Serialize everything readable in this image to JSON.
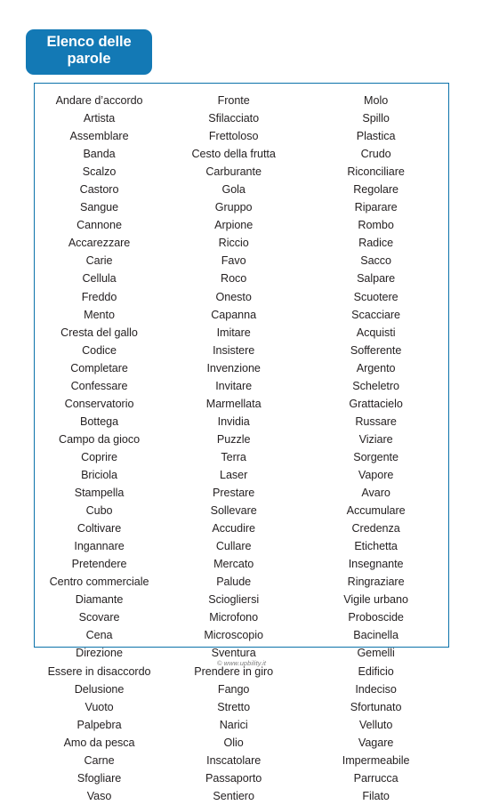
{
  "header": {
    "badge_label": "Elenco delle\nparole",
    "badge_color": "#1379b5",
    "badge_text_color": "#ffffff"
  },
  "word_box": {
    "border_color": "#0b72aa",
    "text_color": "#231f20",
    "columns": [
      {
        "name": "column-1",
        "words": [
          "Andare d’accordo",
          "Artista",
          "Assemblare",
          "Banda",
          "Scalzo",
          "Castoro",
          "Sangue",
          "Cannone",
          "Accarezzare",
          "Carie",
          "Cellula",
          "Freddo",
          "Mento",
          "Cresta del gallo",
          "Codice",
          "Completare",
          "Confessare",
          "Conservatorio",
          "Bottega",
          "Campo da gioco",
          "Coprire",
          "Briciola",
          "Stampella",
          "Cubo",
          "Coltivare",
          "Ingannare",
          "Pretendere",
          "Centro commerciale",
          "Diamante",
          "Scovare",
          "Cena",
          "Direzione",
          "Essere in disaccordo",
          "Delusione",
          "Vuoto",
          "Palpebra",
          "Amo da pesca",
          "Carne",
          "Sfogliare",
          "Vaso"
        ]
      },
      {
        "name": "column-2",
        "words": [
          "Fronte",
          "Sfilacciato",
          "Frettoloso",
          "Cesto della frutta",
          "Carburante",
          "Gola",
          "Gruppo",
          "Arpione",
          "Riccio",
          "Favo",
          "Roco",
          "Onesto",
          "Capanna",
          "Imitare",
          "Insistere",
          "Invenzione",
          "Invitare",
          "Marmellata",
          "Invidia",
          "Puzzle",
          "Terra",
          "Laser",
          "Prestare",
          "Sollevare",
          "Accudire",
          "Cullare",
          "Mercato",
          "Palude",
          "Sciogliersi",
          "Microfono",
          "Microscopio",
          "Sventura",
          "Prendere in giro",
          "Fango",
          "Stretto",
          "Narici",
          "Olio",
          "Inscatolare",
          "Passaporto",
          "Sentiero"
        ]
      },
      {
        "name": "column-3",
        "words": [
          "Molo",
          "Spillo",
          "Plastica",
          "Crudo",
          "Riconciliare",
          "Regolare",
          "Riparare",
          "Rombo",
          "Radice",
          "Sacco",
          "Salpare",
          "Scuotere",
          "Scacciare",
          "Acquisti",
          "Sofferente",
          "Argento",
          "Scheletro",
          "Grattacielo",
          "Russare",
          "Viziare",
          "Sorgente",
          "Vapore",
          "Avaro",
          "Accumulare",
          "Credenza",
          "Etichetta",
          "Insegnante",
          "Ringraziare",
          "Vigile urbano",
          "Proboscide",
          "Bacinella",
          "Gemelli",
          "Edificio",
          "Indeciso",
          "Sfortunato",
          "Velluto",
          "Vagare",
          "Impermeabile",
          "Parrucca",
          "Filato"
        ]
      }
    ]
  },
  "footer": {
    "copyright": "© www.upbility.it"
  }
}
